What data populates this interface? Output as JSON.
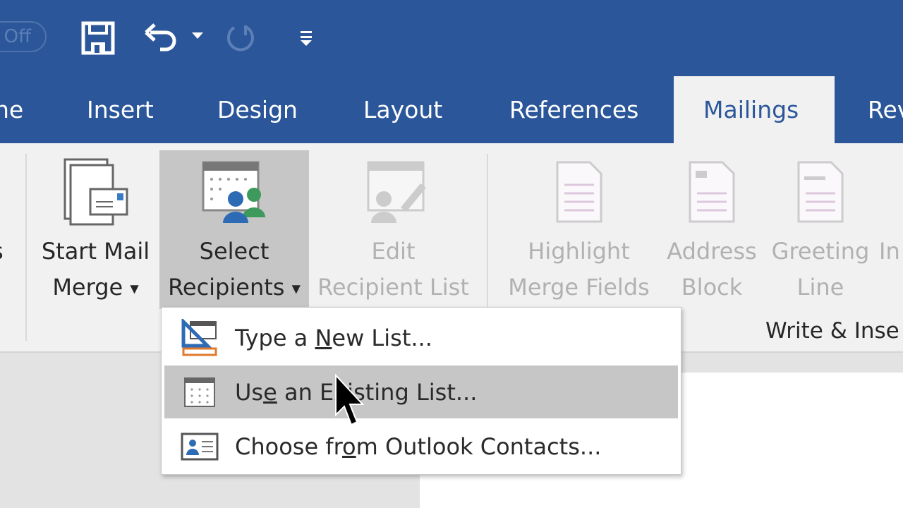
{
  "quick_access": {
    "autosave_label": "Off",
    "icons": [
      "save-icon",
      "undo-icon",
      "redo-icon",
      "customize-icon"
    ]
  },
  "tabs": [
    {
      "label": "ne"
    },
    {
      "label": "Insert"
    },
    {
      "label": "Design"
    },
    {
      "label": "Layout"
    },
    {
      "label": "References"
    },
    {
      "label": "Mailings",
      "active": true
    },
    {
      "label": "Rev"
    }
  ],
  "ribbon": {
    "cut_left_label": "s",
    "buttons": [
      {
        "line1": "Start Mail",
        "line2": "Merge",
        "dropdown": true
      },
      {
        "line1": "Select",
        "line2": "Recipients",
        "dropdown": true,
        "pressed": true
      },
      {
        "line1": "Edit",
        "line2": "Recipient List",
        "disabled": true
      },
      {
        "line1": "Highlight",
        "line2": "Merge Fields",
        "disabled": true
      },
      {
        "line1": "Address",
        "line2": "Block",
        "disabled": true
      },
      {
        "line1": "Greeting",
        "line2": "Line",
        "disabled": true
      },
      {
        "line1": "In",
        "line2": "",
        "disabled": true
      }
    ],
    "group_label": "Write & Inse"
  },
  "menu": {
    "items": [
      {
        "pre": "Type a ",
        "accel": "N",
        "post": "ew List...",
        "icon": "new-list-icon"
      },
      {
        "pre": "Us",
        "accel": "e",
        "post": " an Existing List...",
        "icon": "existing-list-icon",
        "highlighted": true
      },
      {
        "pre": "Choose fr",
        "accel": "o",
        "post": "m Outlook Contacts...",
        "icon": "outlook-contacts-icon"
      }
    ]
  },
  "colors": {
    "brand": "#2b579a",
    "highlight": "#c6c6c6"
  }
}
